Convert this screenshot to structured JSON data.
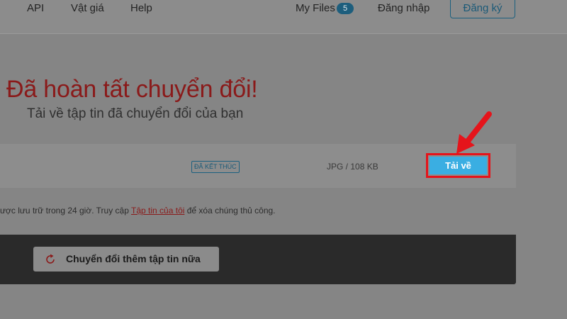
{
  "nav": {
    "api": "API",
    "price": "Vật giá",
    "help": "Help",
    "my_files": "My Files",
    "my_files_count": "5",
    "login": "Đăng nhập",
    "signup": "Đăng ký"
  },
  "header": {
    "title": "Đã hoàn tất chuyển đổi!",
    "subtitle": "Tải về tập tin đã chuyển đổi của bạn"
  },
  "file": {
    "status": "ĐÃ KẾT THÚC",
    "meta": "JPG / 108 KB",
    "download_label": "Tải về"
  },
  "note": {
    "text_before": "ược lưu trữ trong 24 giờ. Truy cập ",
    "link": "Tập tin của tôi",
    "text_after": " để xóa chúng thủ công."
  },
  "actions": {
    "convert_more": "Chuyển đổi thêm tập tin nữa"
  },
  "icons": {
    "refresh": "refresh-icon",
    "annotation": "arrow-icon"
  },
  "colors": {
    "accent": "#3aaee2",
    "highlight": "#e5141b",
    "title": "#8a1a1a"
  }
}
